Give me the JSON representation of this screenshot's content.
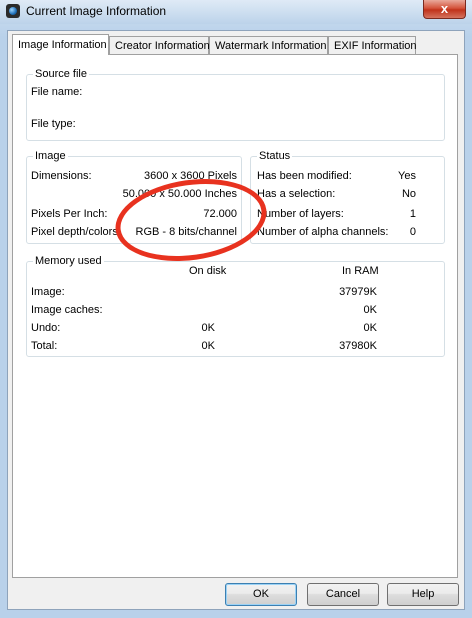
{
  "window": {
    "title": "Current Image Information",
    "close_label": "x"
  },
  "tabs": [
    {
      "label": "Image Information"
    },
    {
      "label": "Creator Information"
    },
    {
      "label": "Watermark Information"
    },
    {
      "label": "EXIF Information"
    }
  ],
  "source_file": {
    "title": "Source file",
    "file_name_label": "File name:",
    "file_type_label": "File type:"
  },
  "image": {
    "title": "Image",
    "dimensions_label": "Dimensions:",
    "dimensions_pixels": "3600 x 3600 Pixels",
    "dimensions_inches": "50.000 x 50.000 Inches",
    "ppi_label": "Pixels Per Inch:",
    "ppi_value": "72.000",
    "depth_label": "Pixel depth/colors:",
    "depth_value": "RGB - 8 bits/channel"
  },
  "status": {
    "title": "Status",
    "modified_label": "Has been modified:",
    "modified_value": "Yes",
    "selection_label": "Has a selection:",
    "selection_value": "No",
    "layers_label": "Number of layers:",
    "layers_value": "1",
    "alpha_label": "Number of alpha channels:",
    "alpha_value": "0"
  },
  "memory": {
    "title": "Memory used",
    "col_disk": "On disk",
    "col_ram": "In RAM",
    "rows": [
      {
        "label": "Image:",
        "disk": "",
        "ram": "37979K"
      },
      {
        "label": "Image caches:",
        "disk": "",
        "ram": "0K"
      },
      {
        "label": "Undo:",
        "disk": "0K",
        "ram": "0K"
      },
      {
        "label": "Total:",
        "disk": "0K",
        "ram": "37980K"
      }
    ]
  },
  "buttons": {
    "ok": "OK",
    "cancel": "Cancel",
    "help": "Help"
  },
  "colors": {
    "annotation_circle": "#e8321f",
    "close_button": "#c0321b"
  }
}
